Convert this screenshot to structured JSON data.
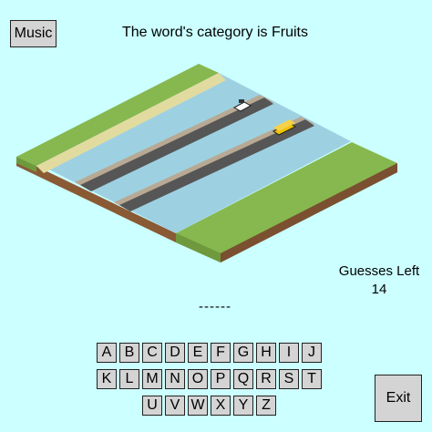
{
  "header": {
    "music_label": "Music",
    "category_text": "The word's category is Fruits"
  },
  "status": {
    "guesses_label": "Guesses Left",
    "guesses_count": "14",
    "word_mask": "------"
  },
  "keyboard": {
    "rows": [
      [
        "A",
        "B",
        "C",
        "D",
        "E",
        "F",
        "G",
        "H",
        "I",
        "J"
      ],
      [
        "K",
        "L",
        "M",
        "N",
        "O",
        "P",
        "Q",
        "R",
        "S",
        "T"
      ],
      [
        "U",
        "V",
        "W",
        "X",
        "Y",
        "Z"
      ]
    ]
  },
  "footer": {
    "exit_label": "Exit"
  },
  "scene": {
    "colors": {
      "grass": "#86b84f",
      "grass_side": "#6e9a3d",
      "dirt_side": "#8a5a35",
      "sand": "#e2dba0",
      "water": "#9dd1e2",
      "road": "#565656",
      "curb": "#b8a994"
    }
  }
}
